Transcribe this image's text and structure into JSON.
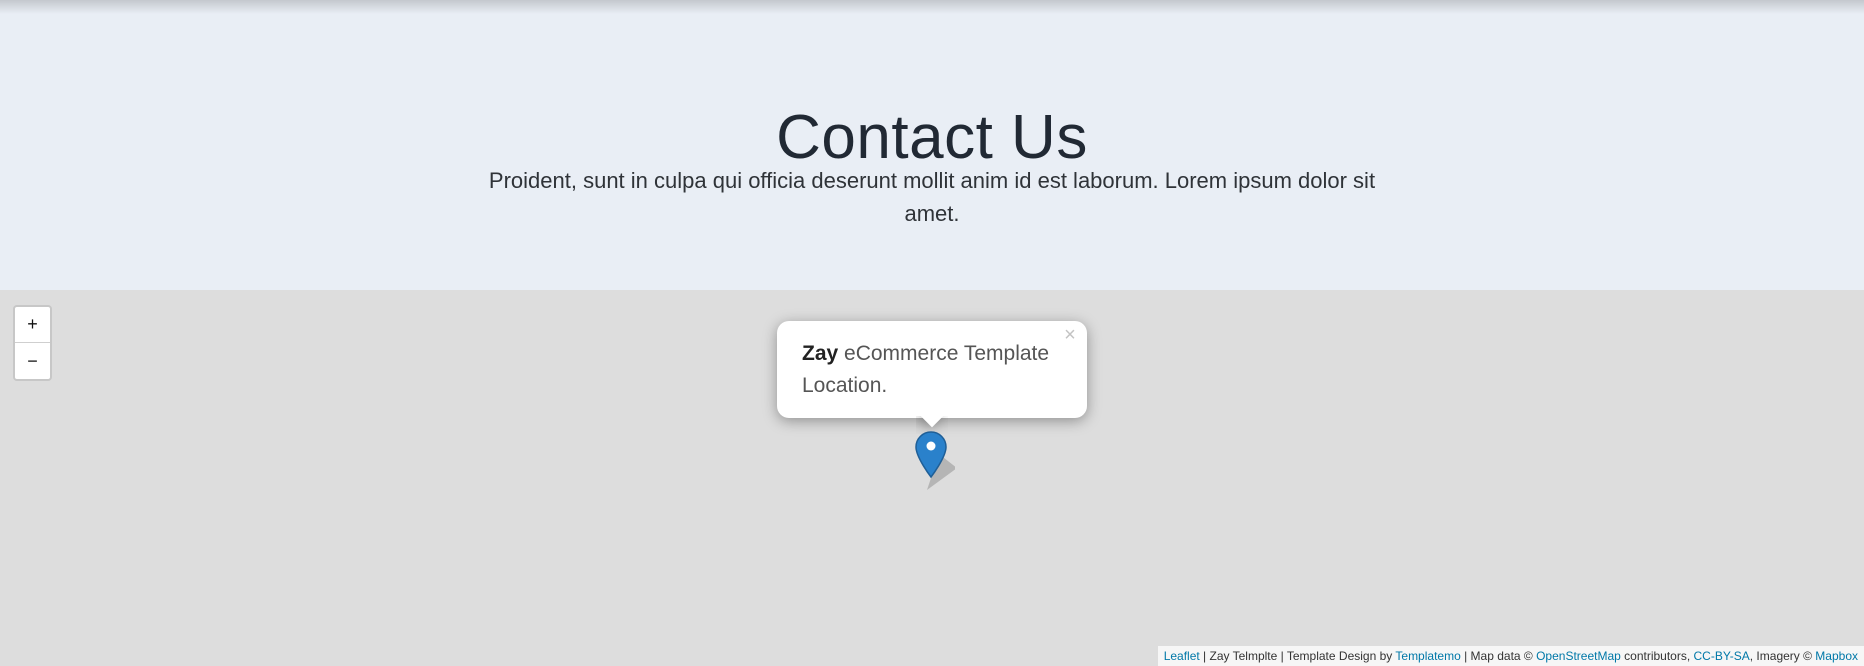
{
  "header": {
    "title": "Contact Us",
    "subtitle": "Proident, sunt in culpa qui officia deserunt mollit anim id est laborum. Lorem ipsum dolor sit amet."
  },
  "map": {
    "zoom_in_label": "+",
    "zoom_out_label": "−",
    "popup": {
      "bold": "Zay",
      "text": " eCommerce Template Location.",
      "close_label": "×"
    },
    "marker_icon": "location-pin",
    "attribution": {
      "leaflet": "Leaflet",
      "sep1": " | Zay Telmplte | Template Design by ",
      "templatemo": "Templatemo",
      "sep2": " | Map data © ",
      "openstreetmap": "OpenStreetMap",
      "sep3": " contributors, ",
      "ccbysa": "CC-BY-SA",
      "sep4": ", Imagery © ",
      "mapbox": "Mapbox"
    }
  },
  "colors": {
    "hero_background": "#e9eef5",
    "map_background": "#dddddd",
    "link": "#0078a8",
    "marker": "#2a81cb"
  }
}
